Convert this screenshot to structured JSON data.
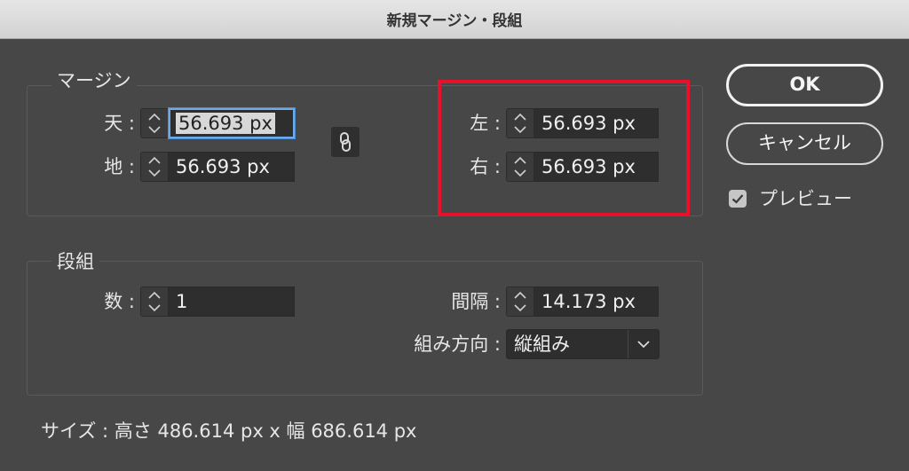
{
  "window": {
    "title": "新規マージン・段組"
  },
  "margin": {
    "label": "マージン",
    "top": {
      "label": "天 :",
      "value": "56.693 px"
    },
    "bottom": {
      "label": "地 :",
      "value": "56.693 px"
    },
    "left": {
      "label": "左 :",
      "value": "56.693 px"
    },
    "right": {
      "label": "右 :",
      "value": "56.693 px"
    },
    "link_icon": "chain-link-icon"
  },
  "columns": {
    "label": "段組",
    "count": {
      "label": "数 :",
      "value": "1"
    },
    "gutter": {
      "label": "間隔 :",
      "value": "14.173 px"
    },
    "direction": {
      "label": "組み方向 :",
      "value": "縦組み"
    }
  },
  "buttons": {
    "ok": "OK",
    "cancel": "キャンセル"
  },
  "preview": {
    "label": "プレビュー",
    "checked": true
  },
  "size_info": "サイズ : 高さ 486.614 px x 幅 686.614 px",
  "colors": {
    "highlight": "#e8102a",
    "focus": "#6fa9e8",
    "background": "#474747"
  }
}
